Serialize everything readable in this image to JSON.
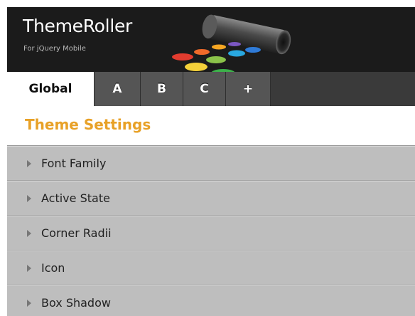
{
  "header": {
    "title": "ThemeRoller",
    "subtitle": "For jQuery Mobile"
  },
  "tabs": [
    {
      "label": "Global",
      "active": true
    },
    {
      "label": "A",
      "active": false
    },
    {
      "label": "B",
      "active": false
    },
    {
      "label": "C",
      "active": false
    },
    {
      "label": "+",
      "active": false
    }
  ],
  "panel": {
    "title": "Theme Settings"
  },
  "accordion": [
    {
      "label": "Font Family",
      "icon": "triangle-right-icon"
    },
    {
      "label": "Active State",
      "icon": "triangle-right-icon"
    },
    {
      "label": "Corner Radii",
      "icon": "triangle-right-icon"
    },
    {
      "label": "Icon",
      "icon": "triangle-right-icon"
    },
    {
      "label": "Box Shadow",
      "icon": "triangle-right-icon"
    }
  ],
  "colors": {
    "header_bg": "#1b1b1b",
    "tab_bg": "#555555",
    "tab_active_bg": "#ffffff",
    "accent": "#e8a127",
    "accordion_bg": "#bebebe"
  }
}
